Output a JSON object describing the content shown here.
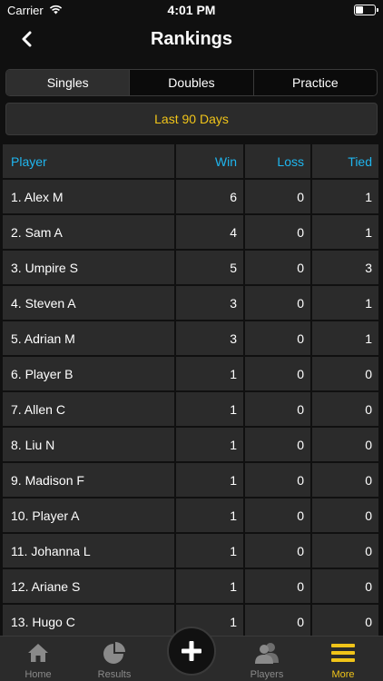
{
  "status_bar": {
    "carrier": "Carrier",
    "time": "4:01 PM"
  },
  "header": {
    "title": "Rankings"
  },
  "segments": [
    {
      "label": "Singles",
      "active": true
    },
    {
      "label": "Doubles",
      "active": false
    },
    {
      "label": "Practice",
      "active": false
    }
  ],
  "period": {
    "label": "Last 90 Days"
  },
  "table": {
    "headers": {
      "player": "Player",
      "win": "Win",
      "loss": "Loss",
      "tied": "Tied"
    },
    "rows": [
      {
        "player": "1. Alex M",
        "win": "6",
        "loss": "0",
        "tied": "1"
      },
      {
        "player": "2. Sam A",
        "win": "4",
        "loss": "0",
        "tied": "1"
      },
      {
        "player": "3. Umpire S",
        "win": "5",
        "loss": "0",
        "tied": "3"
      },
      {
        "player": "4. Steven A",
        "win": "3",
        "loss": "0",
        "tied": "1"
      },
      {
        "player": "5. Adrian M",
        "win": "3",
        "loss": "0",
        "tied": "1"
      },
      {
        "player": "6. Player B",
        "win": "1",
        "loss": "0",
        "tied": "0"
      },
      {
        "player": "7. Allen C",
        "win": "1",
        "loss": "0",
        "tied": "0"
      },
      {
        "player": "8. Liu N",
        "win": "1",
        "loss": "0",
        "tied": "0"
      },
      {
        "player": "9. Madison F",
        "win": "1",
        "loss": "0",
        "tied": "0"
      },
      {
        "player": "10. Player A",
        "win": "1",
        "loss": "0",
        "tied": "0"
      },
      {
        "player": "11. Johanna L",
        "win": "1",
        "loss": "0",
        "tied": "0"
      },
      {
        "player": "12. Ariane S",
        "win": "1",
        "loss": "0",
        "tied": "0"
      },
      {
        "player": "13. Hugo C",
        "win": "1",
        "loss": "0",
        "tied": "0"
      }
    ]
  },
  "tab_bar": {
    "home": "Home",
    "results": "Results",
    "players": "Players",
    "more": "More"
  },
  "colors": {
    "accent": "#f0c419",
    "header_text": "#1fb6ef",
    "cell_bg": "#2b2b2b",
    "background": "#101010"
  }
}
